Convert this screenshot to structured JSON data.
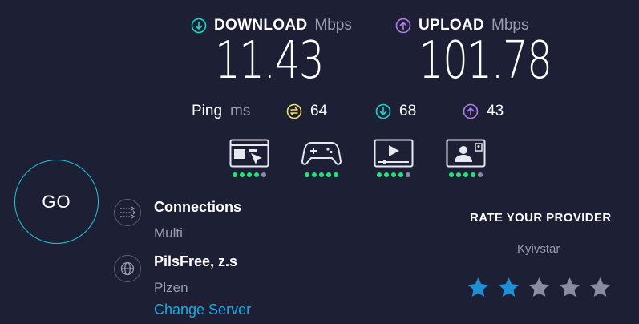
{
  "download": {
    "label": "DOWNLOAD",
    "unit": "Mbps",
    "value": "11.43",
    "color": "#1fd6c8"
  },
  "upload": {
    "label": "UPLOAD",
    "unit": "Mbps",
    "value": "101.78",
    "color": "#b07df0"
  },
  "ping": {
    "label": "Ping",
    "unit": "ms",
    "idle": "64",
    "download": "68",
    "upload": "43",
    "idle_color": "#f5e06a"
  },
  "experience": [
    {
      "icon": "web-browsing-icon",
      "level": 4,
      "max": 5
    },
    {
      "icon": "gaming-controller-icon",
      "level": 5,
      "max": 5
    },
    {
      "icon": "video-streaming-icon",
      "level": 4,
      "max": 5
    },
    {
      "icon": "video-call-icon",
      "level": 4,
      "max": 5
    }
  ],
  "go_label": "GO",
  "connections": {
    "title": "Connections",
    "value": "Multi",
    "icon": "connections-icon"
  },
  "server": {
    "name": "PilsFree, z.s",
    "location": "Plzen",
    "change_label": "Change Server",
    "icon": "globe-icon"
  },
  "rating": {
    "title": "RATE YOUR PROVIDER",
    "provider": "Kyivstar",
    "stars": 2,
    "max": 5,
    "active_color": "#1e8fd6",
    "inactive_color": "#8a8ca0"
  }
}
